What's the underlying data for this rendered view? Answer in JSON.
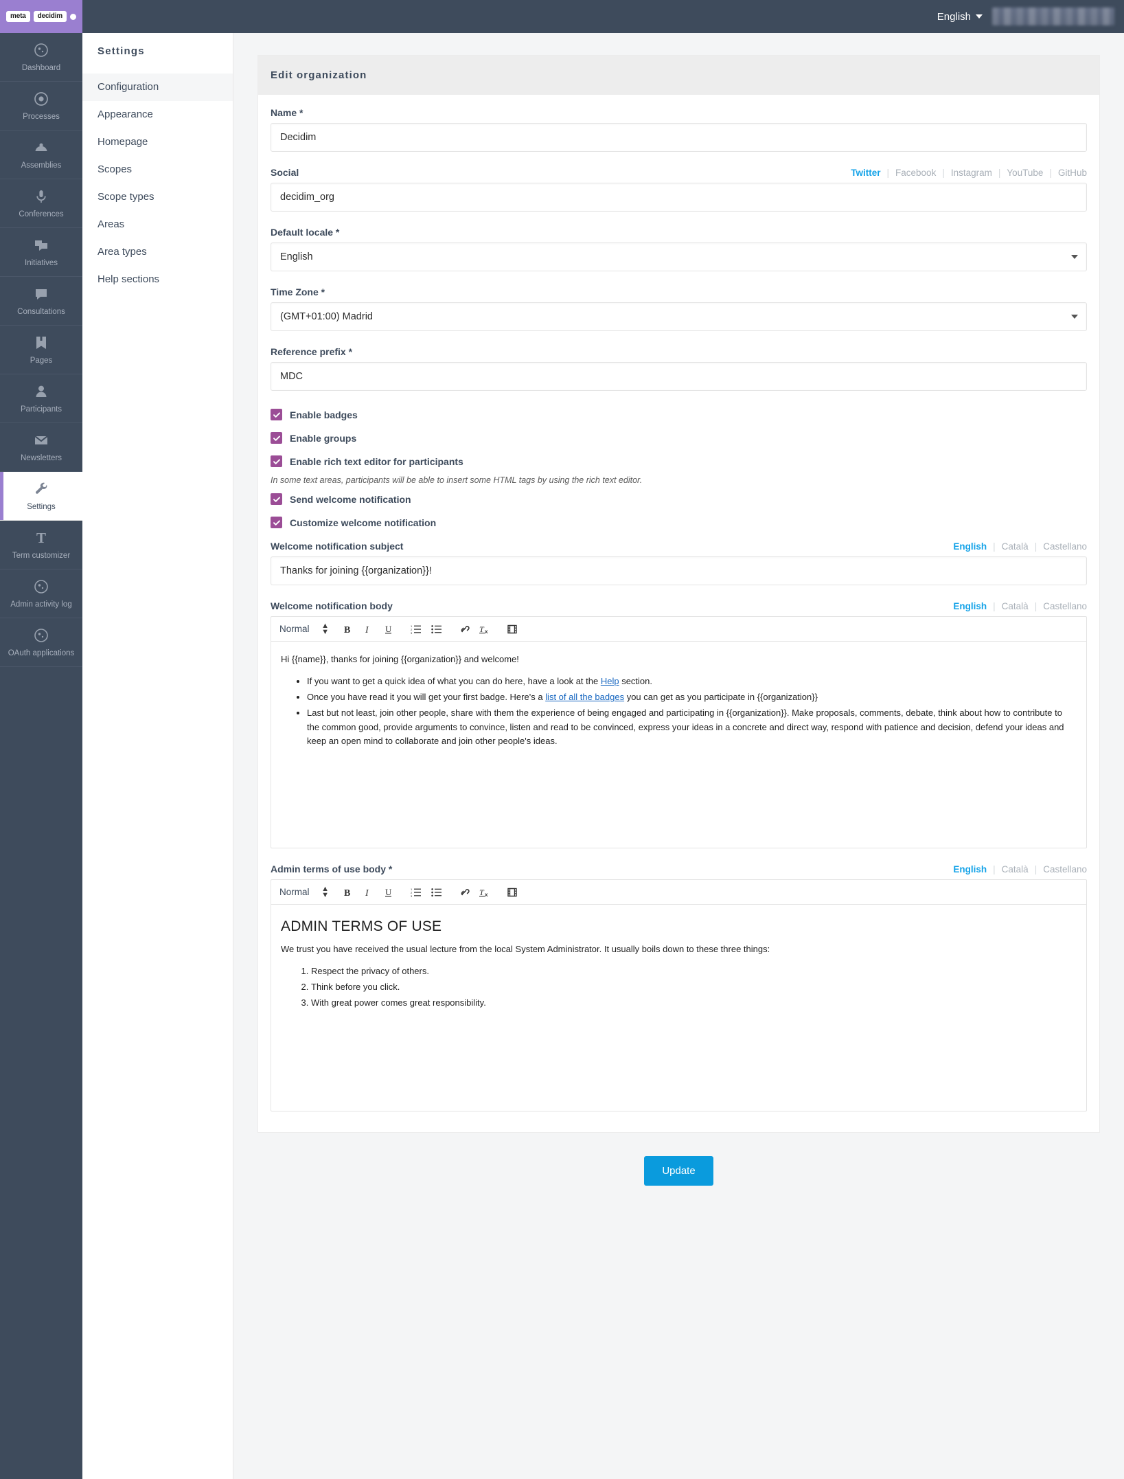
{
  "topbar": {
    "brand": {
      "part1": "meta",
      "part2": "decidim"
    },
    "language": "English",
    "user_redacted": ""
  },
  "sidebar": {
    "items": [
      {
        "label": "Dashboard",
        "icon": "globe-icon",
        "active": false
      },
      {
        "label": "Processes",
        "icon": "target-icon",
        "active": false
      },
      {
        "label": "Assemblies",
        "icon": "assembly-icon",
        "active": false
      },
      {
        "label": "Conferences",
        "icon": "microphone-icon",
        "active": false
      },
      {
        "label": "Initiatives",
        "icon": "speech-bubbles-icon",
        "active": false
      },
      {
        "label": "Consultations",
        "icon": "speech-bubble-icon",
        "active": false
      },
      {
        "label": "Pages",
        "icon": "book-icon",
        "active": false
      },
      {
        "label": "Participants",
        "icon": "user-icon",
        "active": false
      },
      {
        "label": "Newsletters",
        "icon": "envelope-icon",
        "active": false
      },
      {
        "label": "Settings",
        "icon": "wrench-icon",
        "active": true
      },
      {
        "label": "Term customizer",
        "icon": "letter-t-icon",
        "active": false
      },
      {
        "label": "Admin activity log",
        "icon": "globe-icon",
        "active": false
      },
      {
        "label": "OAuth applications",
        "icon": "globe-icon",
        "active": false
      }
    ]
  },
  "subnav": {
    "title": "Settings",
    "items": [
      {
        "label": "Configuration",
        "active": true
      },
      {
        "label": "Appearance",
        "active": false
      },
      {
        "label": "Homepage",
        "active": false
      },
      {
        "label": "Scopes",
        "active": false
      },
      {
        "label": "Scope types",
        "active": false
      },
      {
        "label": "Areas",
        "active": false
      },
      {
        "label": "Area types",
        "active": false
      },
      {
        "label": "Help sections",
        "active": false
      }
    ]
  },
  "form": {
    "card_title": "Edit organization",
    "name": {
      "label": "Name",
      "required": "*",
      "value": "Decidim"
    },
    "social": {
      "label": "Social",
      "value": "decidim_org",
      "tabs": [
        "Twitter",
        "Facebook",
        "Instagram",
        "YouTube",
        "GitHub"
      ],
      "active_tab": "Twitter"
    },
    "default_locale": {
      "label": "Default locale",
      "required": "*",
      "value": "English"
    },
    "time_zone": {
      "label": "Time Zone",
      "required": "*",
      "value": "(GMT+01:00) Madrid"
    },
    "reference_prefix": {
      "label": "Reference prefix",
      "required": "*",
      "value": "MDC"
    },
    "checkboxes": [
      {
        "label": "Enable badges",
        "checked": true
      },
      {
        "label": "Enable groups",
        "checked": true
      },
      {
        "label": "Enable rich text editor for participants",
        "checked": true
      }
    ],
    "rich_text_hint": "In some text areas, participants will be able to insert some HTML tags by using the rich text editor.",
    "checkboxes2": [
      {
        "label": "Send welcome notification",
        "checked": true
      },
      {
        "label": "Customize welcome notification",
        "checked": true
      }
    ],
    "locale_tabs": [
      "English",
      "Català",
      "Castellano"
    ],
    "locale_active": "English",
    "welcome_subject": {
      "label": "Welcome notification subject",
      "value": "Thanks for joining {{organization}}!"
    },
    "welcome_body": {
      "label": "Welcome notification body",
      "toolbar": {
        "format": "Normal",
        "tools": [
          "bold",
          "italic",
          "underline",
          "ordered-list",
          "bullet-list",
          "link",
          "clear-format",
          "video"
        ]
      },
      "intro": "Hi {{name}}, thanks for joining {{organization}} and welcome!",
      "bullets": [
        {
          "pre": "If you want to get a quick idea of what you can do here, have a look at the ",
          "link": "Help",
          "post": " section."
        },
        {
          "pre": "Once you have read it you will get your first badge. Here's a ",
          "link": "list of all the badges",
          "post": " you can get as you participate in {{organization}}"
        },
        {
          "pre": "Last but not least, join other people, share with them the experience of being engaged and participating in {{organization}}. Make proposals, comments, debate, think about how to contribute to the common good, provide arguments to convince, listen and read to be convinced, express your ideas in a concrete and direct way, respond with patience and decision, defend your ideas and keep an open mind to collaborate and join other people's ideas.",
          "link": "",
          "post": ""
        }
      ]
    },
    "admin_terms": {
      "label": "Admin terms of use body",
      "required": "*",
      "toolbar": {
        "format": "Normal"
      },
      "heading": "ADMIN TERMS OF USE",
      "paragraph": "We trust you have received the usual lecture from the local System Administrator. It usually boils down to these three things:",
      "items": [
        "Respect the privacy of others.",
        "Think before you click.",
        "With great power comes great responsibility."
      ]
    },
    "submit_label": "Update"
  },
  "colors": {
    "brand_purple": "#9a7fd0",
    "checkbox_purple": "#9b4d96",
    "accent_blue": "#0a9bdd",
    "link_blue": "#15a3e8",
    "sidebar_dark": "#3e4b5c"
  }
}
